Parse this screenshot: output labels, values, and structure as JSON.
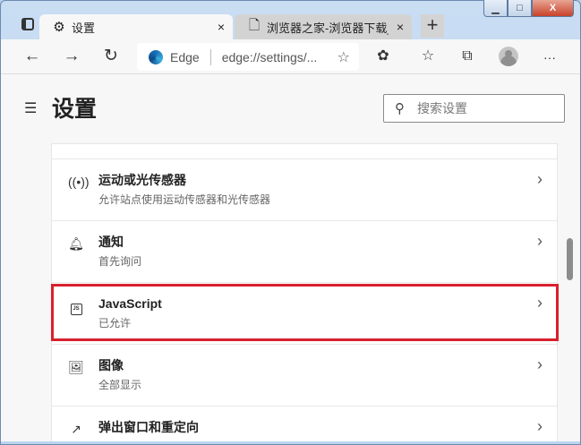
{
  "window": {
    "min": "▁",
    "max": "□",
    "close": "X"
  },
  "tabs": [
    {
      "label": "设置",
      "icon": "gear-icon",
      "close": "×"
    },
    {
      "label": "浏览器之家-浏览器下载_浏",
      "icon": "page-icon",
      "close": "×"
    }
  ],
  "new_tab": "+",
  "toolbar": {
    "back": "←",
    "forward": "→",
    "refresh": "↻",
    "site": "Edge",
    "url": "edge://settings/...",
    "more": "···"
  },
  "header": {
    "title": "设置",
    "search_placeholder": "搜索设置"
  },
  "rows": [
    {
      "title": "运动或光传感器",
      "subtitle": "允许站点使用运动传感器和光传感器",
      "icon": "sensor-icon"
    },
    {
      "title": "通知",
      "subtitle": "首先询问",
      "icon": "bell-icon"
    },
    {
      "title": "JavaScript",
      "subtitle": "已允许",
      "icon": "js-icon"
    },
    {
      "title": "图像",
      "subtitle": "全部显示",
      "icon": "image-icon"
    },
    {
      "title": "弹出窗口和重定向",
      "subtitle": "",
      "icon": "popup-icon"
    }
  ],
  "js_icon_text": "JS",
  "highlight_color": "#d8202e"
}
